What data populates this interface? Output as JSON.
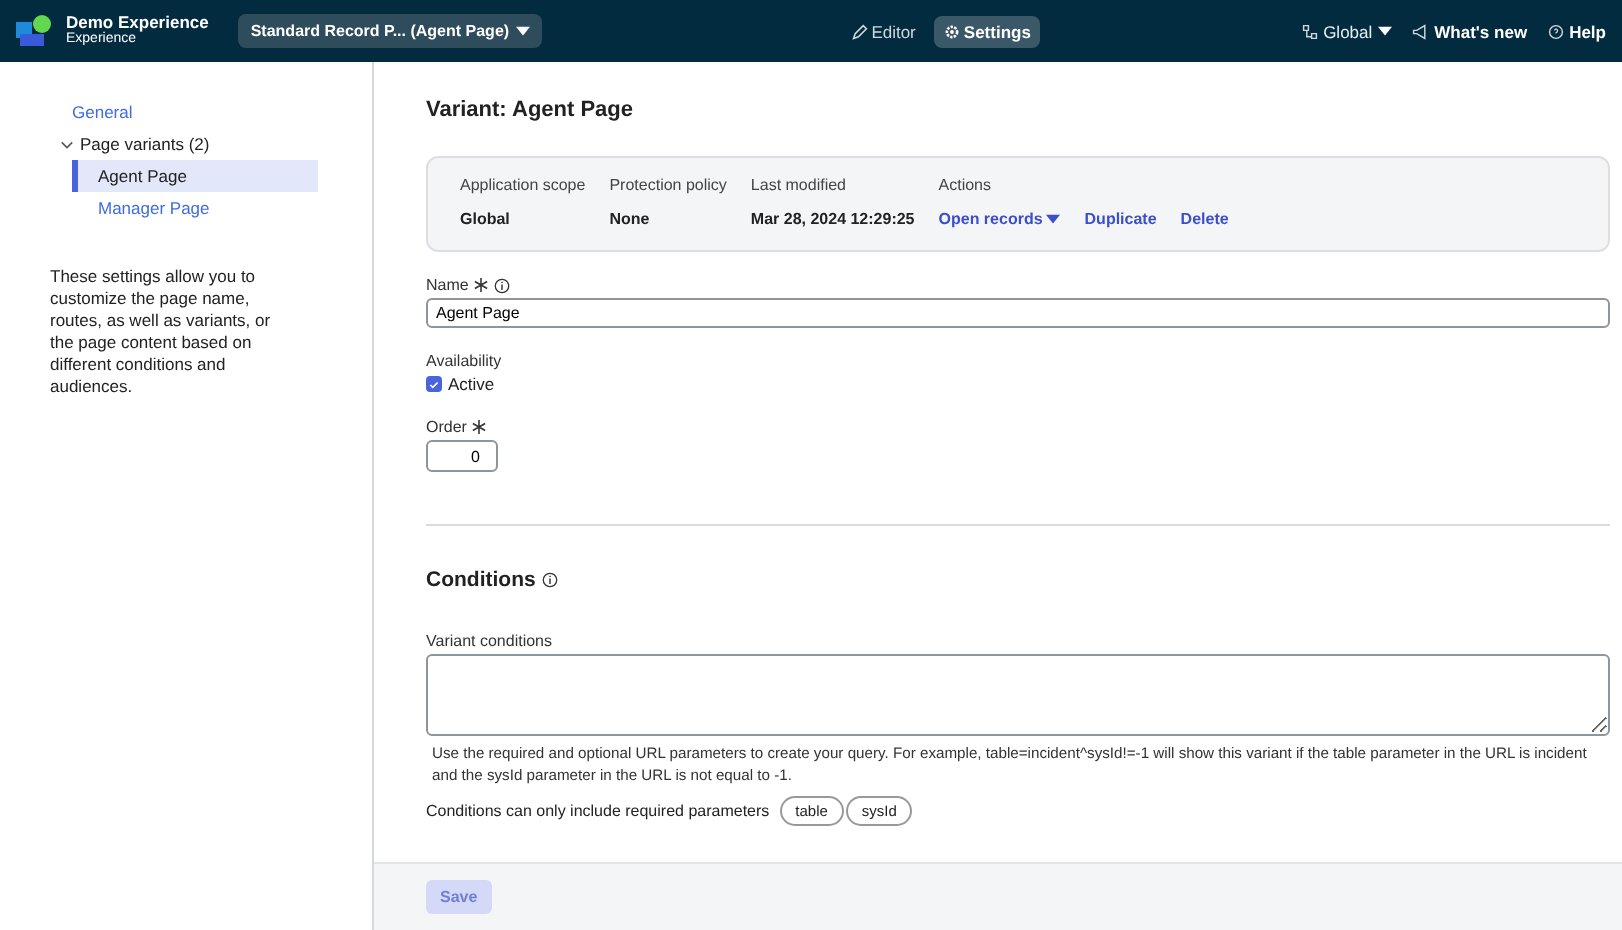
{
  "header": {
    "app_name": "Demo Experience",
    "app_subtitle": "Experience",
    "page_selector": "Standard Record P...  (Agent Page)",
    "modes": [
      {
        "label": "Editor",
        "kind": "pencil",
        "selected": false
      },
      {
        "label": "Settings",
        "kind": "gear",
        "selected": true
      }
    ],
    "right_items": [
      {
        "label": "Global",
        "kind": "scope",
        "dropdown": true
      },
      {
        "label": "What's new",
        "kind": "megaphone",
        "dropdown": false
      },
      {
        "label": "Help",
        "kind": "help",
        "dropdown": false
      }
    ]
  },
  "sidebar": {
    "items": [
      {
        "label": "General",
        "selected": false
      },
      {
        "label": "Page variants (2)",
        "expanded": true,
        "selected": false,
        "children": [
          {
            "label": "Agent Page",
            "selected": true
          },
          {
            "label": "Manager Page",
            "selected": false
          }
        ]
      }
    ],
    "description": "These settings allow you to customize the page name, routes, as well as variants, or the page content based on different conditions and audiences."
  },
  "main": {
    "title": "Variant: Agent Page",
    "info_card": {
      "columns": [
        {
          "label": "Application scope",
          "value": "Global"
        },
        {
          "label": "Protection policy",
          "value": "None"
        },
        {
          "label": "Last modified",
          "value": "Mar 28, 2024 12:29:25"
        }
      ],
      "actions_label": "Actions",
      "actions": [
        {
          "label": "Open records",
          "dropdown": true
        },
        {
          "label": "Duplicate",
          "dropdown": false
        },
        {
          "label": "Delete",
          "dropdown": false
        }
      ]
    },
    "name_field": {
      "label": "Name",
      "required": true,
      "info": true,
      "value": "Agent Page"
    },
    "availability": {
      "label": "Availability",
      "option": "Active",
      "checked": true
    },
    "order_field": {
      "label": "Order",
      "required": true,
      "value": "0"
    },
    "conditions": {
      "title": "Conditions",
      "field_label": "Variant conditions",
      "help": "Use the required and optional URL parameters to create your query. For example, table=incident^sysId!=-1 will show this variant if the table parameter in the URL is incident and the sysId parameter in the URL is not equal to -1.",
      "params_label": "Conditions can only include required parameters",
      "params": [
        "table",
        "sysId"
      ]
    },
    "save": {
      "label": "Save",
      "disabled": true
    }
  }
}
